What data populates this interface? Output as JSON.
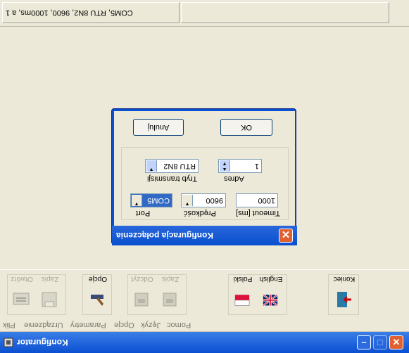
{
  "window": {
    "title": "Konfigurator"
  },
  "statusbar": {
    "connection_text": "COM5, RTU 8N2, 9600, 1000ms, a 1"
  },
  "menubar": {
    "items": [
      "Plik",
      "Urządzenie",
      "Parametry",
      "Opcje",
      "Język",
      "Pomoc"
    ]
  },
  "toolbar": {
    "open_label": "Otwórz",
    "save_label": "Zapis",
    "options_label": "Opcje",
    "read_label": "Odczyt",
    "write_label": "Zapis",
    "polish_label": "Polski",
    "english_label": "English",
    "exit_label": "Koniec"
  },
  "dialog": {
    "title": "Konfiguracja połączenia",
    "ok_label": "OK",
    "cancel_label": "Anuluj",
    "port_label": "Port",
    "port_value": "COM5",
    "speed_label": "Prędkość",
    "speed_value": "9600",
    "timeout_label": "Timeout [ms]",
    "timeout_value": "1000",
    "mode_label": "Tryb transmisji",
    "mode_value": "RTU 8N2",
    "address_label": "Adres",
    "address_value": "1"
  }
}
